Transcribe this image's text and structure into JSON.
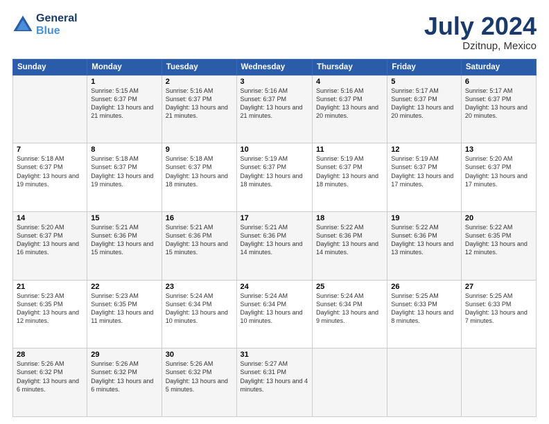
{
  "header": {
    "logo_line1": "General",
    "logo_line2": "Blue",
    "month_title": "July 2024",
    "location": "Dzitnup, Mexico"
  },
  "calendar": {
    "weekdays": [
      "Sunday",
      "Monday",
      "Tuesday",
      "Wednesday",
      "Thursday",
      "Friday",
      "Saturday"
    ],
    "rows": [
      [
        {
          "day": "",
          "sunrise": "",
          "sunset": "",
          "daylight": ""
        },
        {
          "day": "1",
          "sunrise": "Sunrise: 5:15 AM",
          "sunset": "Sunset: 6:37 PM",
          "daylight": "Daylight: 13 hours and 21 minutes."
        },
        {
          "day": "2",
          "sunrise": "Sunrise: 5:16 AM",
          "sunset": "Sunset: 6:37 PM",
          "daylight": "Daylight: 13 hours and 21 minutes."
        },
        {
          "day": "3",
          "sunrise": "Sunrise: 5:16 AM",
          "sunset": "Sunset: 6:37 PM",
          "daylight": "Daylight: 13 hours and 21 minutes."
        },
        {
          "day": "4",
          "sunrise": "Sunrise: 5:16 AM",
          "sunset": "Sunset: 6:37 PM",
          "daylight": "Daylight: 13 hours and 20 minutes."
        },
        {
          "day": "5",
          "sunrise": "Sunrise: 5:17 AM",
          "sunset": "Sunset: 6:37 PM",
          "daylight": "Daylight: 13 hours and 20 minutes."
        },
        {
          "day": "6",
          "sunrise": "Sunrise: 5:17 AM",
          "sunset": "Sunset: 6:37 PM",
          "daylight": "Daylight: 13 hours and 20 minutes."
        }
      ],
      [
        {
          "day": "7",
          "sunrise": "Sunrise: 5:18 AM",
          "sunset": "Sunset: 6:37 PM",
          "daylight": "Daylight: 13 hours and 19 minutes."
        },
        {
          "day": "8",
          "sunrise": "Sunrise: 5:18 AM",
          "sunset": "Sunset: 6:37 PM",
          "daylight": "Daylight: 13 hours and 19 minutes."
        },
        {
          "day": "9",
          "sunrise": "Sunrise: 5:18 AM",
          "sunset": "Sunset: 6:37 PM",
          "daylight": "Daylight: 13 hours and 18 minutes."
        },
        {
          "day": "10",
          "sunrise": "Sunrise: 5:19 AM",
          "sunset": "Sunset: 6:37 PM",
          "daylight": "Daylight: 13 hours and 18 minutes."
        },
        {
          "day": "11",
          "sunrise": "Sunrise: 5:19 AM",
          "sunset": "Sunset: 6:37 PM",
          "daylight": "Daylight: 13 hours and 18 minutes."
        },
        {
          "day": "12",
          "sunrise": "Sunrise: 5:19 AM",
          "sunset": "Sunset: 6:37 PM",
          "daylight": "Daylight: 13 hours and 17 minutes."
        },
        {
          "day": "13",
          "sunrise": "Sunrise: 5:20 AM",
          "sunset": "Sunset: 6:37 PM",
          "daylight": "Daylight: 13 hours and 17 minutes."
        }
      ],
      [
        {
          "day": "14",
          "sunrise": "Sunrise: 5:20 AM",
          "sunset": "Sunset: 6:37 PM",
          "daylight": "Daylight: 13 hours and 16 minutes."
        },
        {
          "day": "15",
          "sunrise": "Sunrise: 5:21 AM",
          "sunset": "Sunset: 6:36 PM",
          "daylight": "Daylight: 13 hours and 15 minutes."
        },
        {
          "day": "16",
          "sunrise": "Sunrise: 5:21 AM",
          "sunset": "Sunset: 6:36 PM",
          "daylight": "Daylight: 13 hours and 15 minutes."
        },
        {
          "day": "17",
          "sunrise": "Sunrise: 5:21 AM",
          "sunset": "Sunset: 6:36 PM",
          "daylight": "Daylight: 13 hours and 14 minutes."
        },
        {
          "day": "18",
          "sunrise": "Sunrise: 5:22 AM",
          "sunset": "Sunset: 6:36 PM",
          "daylight": "Daylight: 13 hours and 14 minutes."
        },
        {
          "day": "19",
          "sunrise": "Sunrise: 5:22 AM",
          "sunset": "Sunset: 6:36 PM",
          "daylight": "Daylight: 13 hours and 13 minutes."
        },
        {
          "day": "20",
          "sunrise": "Sunrise: 5:22 AM",
          "sunset": "Sunset: 6:35 PM",
          "daylight": "Daylight: 13 hours and 12 minutes."
        }
      ],
      [
        {
          "day": "21",
          "sunrise": "Sunrise: 5:23 AM",
          "sunset": "Sunset: 6:35 PM",
          "daylight": "Daylight: 13 hours and 12 minutes."
        },
        {
          "day": "22",
          "sunrise": "Sunrise: 5:23 AM",
          "sunset": "Sunset: 6:35 PM",
          "daylight": "Daylight: 13 hours and 11 minutes."
        },
        {
          "day": "23",
          "sunrise": "Sunrise: 5:24 AM",
          "sunset": "Sunset: 6:34 PM",
          "daylight": "Daylight: 13 hours and 10 minutes."
        },
        {
          "day": "24",
          "sunrise": "Sunrise: 5:24 AM",
          "sunset": "Sunset: 6:34 PM",
          "daylight": "Daylight: 13 hours and 10 minutes."
        },
        {
          "day": "25",
          "sunrise": "Sunrise: 5:24 AM",
          "sunset": "Sunset: 6:34 PM",
          "daylight": "Daylight: 13 hours and 9 minutes."
        },
        {
          "day": "26",
          "sunrise": "Sunrise: 5:25 AM",
          "sunset": "Sunset: 6:33 PM",
          "daylight": "Daylight: 13 hours and 8 minutes."
        },
        {
          "day": "27",
          "sunrise": "Sunrise: 5:25 AM",
          "sunset": "Sunset: 6:33 PM",
          "daylight": "Daylight: 13 hours and 7 minutes."
        }
      ],
      [
        {
          "day": "28",
          "sunrise": "Sunrise: 5:26 AM",
          "sunset": "Sunset: 6:32 PM",
          "daylight": "Daylight: 13 hours and 6 minutes."
        },
        {
          "day": "29",
          "sunrise": "Sunrise: 5:26 AM",
          "sunset": "Sunset: 6:32 PM",
          "daylight": "Daylight: 13 hours and 6 minutes."
        },
        {
          "day": "30",
          "sunrise": "Sunrise: 5:26 AM",
          "sunset": "Sunset: 6:32 PM",
          "daylight": "Daylight: 13 hours and 5 minutes."
        },
        {
          "day": "31",
          "sunrise": "Sunrise: 5:27 AM",
          "sunset": "Sunset: 6:31 PM",
          "daylight": "Daylight: 13 hours and 4 minutes."
        },
        {
          "day": "",
          "sunrise": "",
          "sunset": "",
          "daylight": ""
        },
        {
          "day": "",
          "sunrise": "",
          "sunset": "",
          "daylight": ""
        },
        {
          "day": "",
          "sunrise": "",
          "sunset": "",
          "daylight": ""
        }
      ]
    ]
  }
}
